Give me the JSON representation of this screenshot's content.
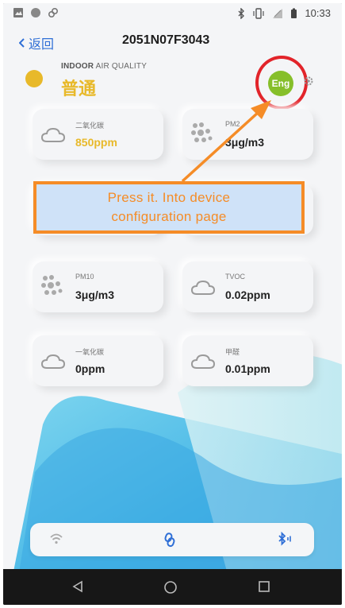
{
  "status_bar": {
    "time": "10:33",
    "left_icons": [
      "image-icon",
      "circle-icon",
      "link-icon"
    ],
    "right_icons": [
      "bluetooth-icon",
      "vibrate-icon",
      "signal-icon",
      "battery-icon"
    ]
  },
  "header": {
    "back_label": "返回",
    "title": "2051N07F3043"
  },
  "air_quality": {
    "subtitle_bold": "INDOOR",
    "subtitle_rest": " AIR QUALITY",
    "level": "普通",
    "indicator_color": "#e8b92a",
    "lang_button": "Eng"
  },
  "cards": [
    {
      "label": "二氧化碳",
      "value": "850ppm",
      "icon": "cloud-icon",
      "highlight": true
    },
    {
      "label": "PM2",
      "value": "3μg/m3",
      "icon": "dots-icon",
      "highlight": false
    },
    {
      "label": "PM10",
      "value": "3μg/m3",
      "icon": "dots-icon",
      "highlight": false
    },
    {
      "label": "TVOC",
      "value": "0.02ppm",
      "icon": "cloud-icon",
      "highlight": false
    },
    {
      "label": "一氧化碳",
      "value": "0ppm",
      "icon": "cloud-icon",
      "highlight": false
    },
    {
      "label": "甲醛",
      "value": "0.01ppm",
      "icon": "cloud-icon",
      "highlight": false
    }
  ],
  "annotation": {
    "line1": "Press it. Into device",
    "line2": "configuration page",
    "color": "#f58c27"
  },
  "bottom_bar": {
    "icons": [
      "wifi-icon",
      "link-icon",
      "bluetooth-icon"
    ]
  },
  "nav_bar": {
    "icons": [
      "back-icon",
      "home-icon",
      "recent-apps-icon"
    ]
  }
}
